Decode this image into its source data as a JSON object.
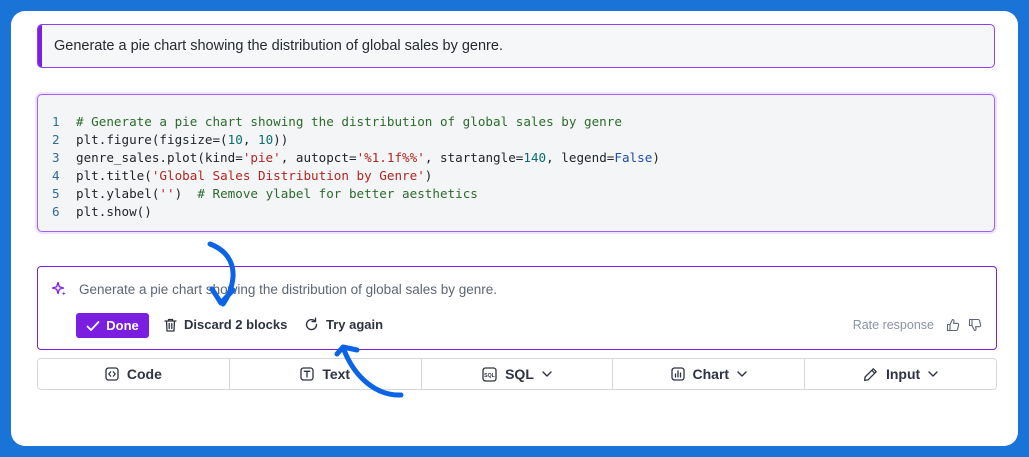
{
  "prompt_cell": {
    "text": "Generate a pie chart showing the distribution of global sales by genre."
  },
  "code_cell": {
    "line_numbers": [
      "1",
      "2",
      "3",
      "4",
      "5",
      "6"
    ],
    "line1": "# Generate a pie chart showing the distribution of global sales by genre",
    "line2_a": "plt.figure(figsize=(",
    "line2_n1": "10",
    "line2_b": ", ",
    "line2_n2": "10",
    "line2_c": "))",
    "line3_a": "genre_sales.plot(kind=",
    "line3_s1": "'pie'",
    "line3_b": ", autopct=",
    "line3_s2": "'%1.1f%%'",
    "line3_c": ", startangle=",
    "line3_n1": "140",
    "line3_d": ", legend=",
    "line3_k": "False",
    "line3_e": ")",
    "line4_a": "plt.title(",
    "line4_s": "'Global Sales Distribution by Genre'",
    "line4_b": ")",
    "line5_a": "plt.ylabel(",
    "line5_s": "''",
    "line5_b": ")  ",
    "line5_c": "# Remove ylabel for better aesthetics",
    "line6": "plt.show()"
  },
  "ai_cell": {
    "icon": "sparkle-icon",
    "prompt_text": "Generate a pie chart showing the distribution of global sales by genre.",
    "done_label": "Done",
    "discard_label": "Discard 2 blocks",
    "retry_label": "Try again",
    "rate_label": "Rate response"
  },
  "toolbar": {
    "code_label": "Code",
    "text_label": "Text",
    "sql_label": "SQL",
    "chart_label": "Chart",
    "input_label": "Input"
  },
  "colors": {
    "background": "#1a73d6",
    "accent": "#7a1fdf",
    "annotation_arrow": "#0b63e5"
  }
}
